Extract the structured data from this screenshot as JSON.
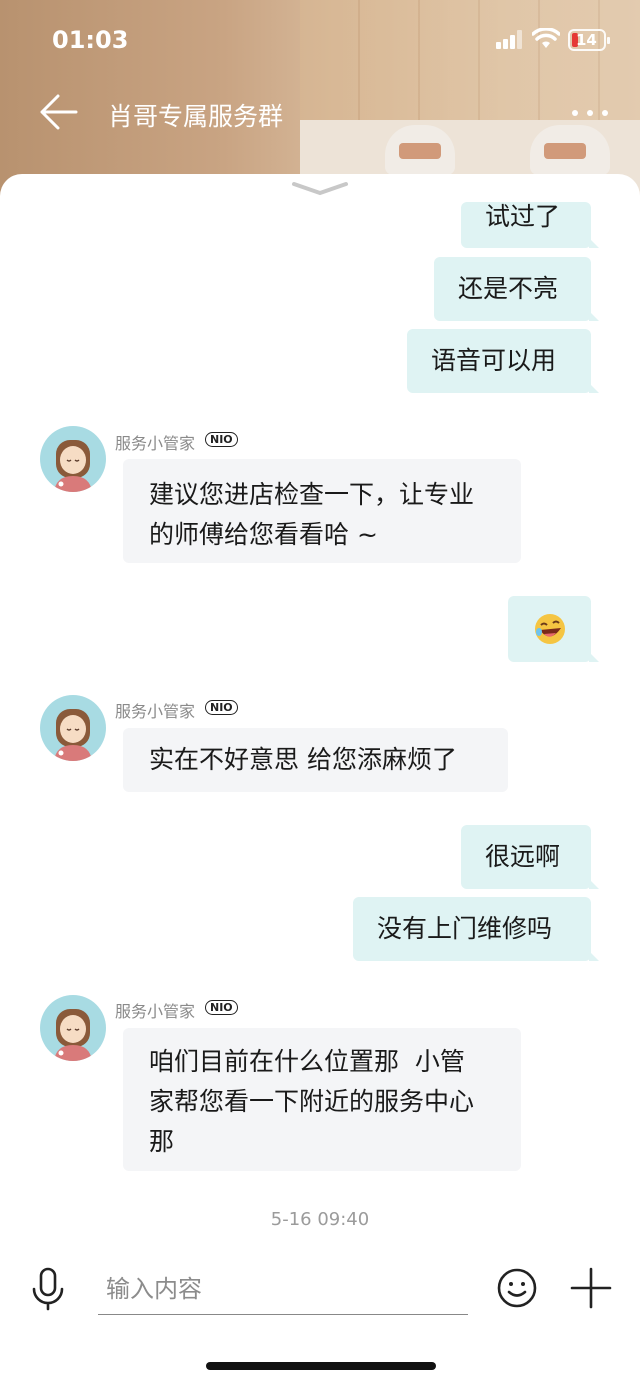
{
  "status_bar": {
    "time": "01:03",
    "battery_level": "14"
  },
  "header": {
    "title": "肖哥专属服务群"
  },
  "messages": {
    "out1": "试过了",
    "out2": "还是不亮",
    "out3": "语音可以用",
    "in1_sender": "服务小管家",
    "in1_badge": "NIO",
    "in1_line1": "建议您进店检查一下，让专业",
    "in1_line2": "的师傅给您看看哈 ~",
    "out4_emoji": "laughing-emoji",
    "in2_sender": "服务小管家",
    "in2_badge": "NIO",
    "in2_text": "实在不好意思 给您添麻烦了",
    "out5": "很远啊",
    "out6": "没有上门维修吗",
    "in3_sender": "服务小管家",
    "in3_badge": "NIO",
    "in3_line1": "咱们目前在什么位置那  小管",
    "in3_line2": "家帮您看一下附近的服务中心",
    "in3_line3": "那",
    "timestamp": "5-16 09:40"
  },
  "input": {
    "placeholder": "输入内容"
  },
  "colors": {
    "out_bubble": "#dff3f3",
    "in_bubble": "#f4f5f7",
    "avatar_bg": "#a8dbe3"
  }
}
